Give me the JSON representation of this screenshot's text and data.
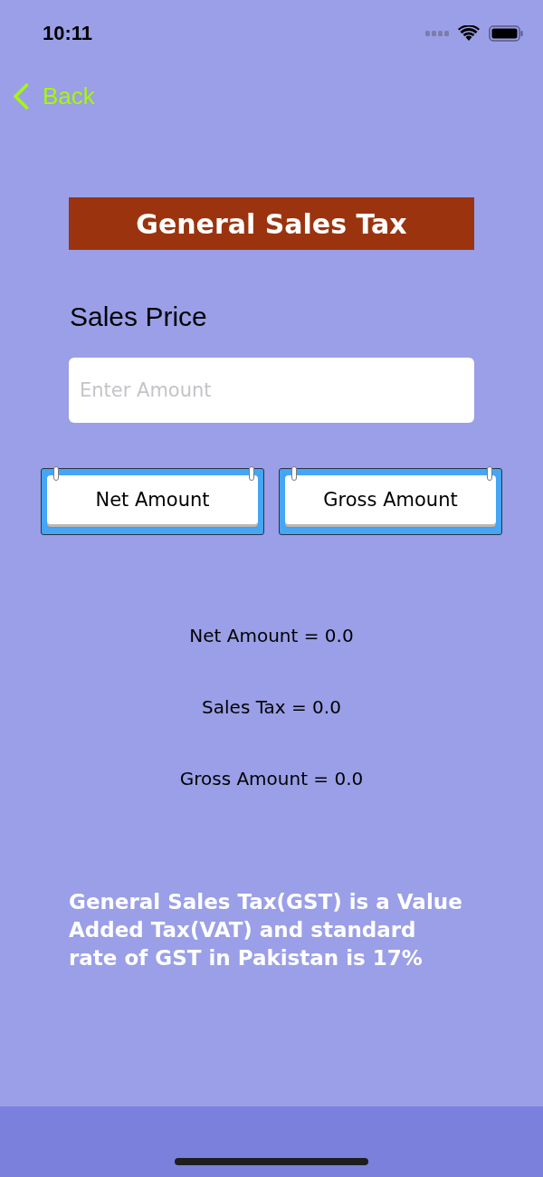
{
  "status_bar": {
    "time": "10:11"
  },
  "nav": {
    "back_label": "Back"
  },
  "title": "General Sales Tax",
  "sales_price": {
    "label": "Sales Price",
    "placeholder": "Enter Amount"
  },
  "buttons": [
    "Net Amount",
    "Gross Amount"
  ],
  "results": [
    "Net Amount = 0.0",
    "Sales Tax = 0.0",
    "Gross Amount = 0.0"
  ],
  "info": "General Sales Tax(GST) is a Value Added Tax(VAT) and standard rate of GST in Pakistan is 17%"
}
